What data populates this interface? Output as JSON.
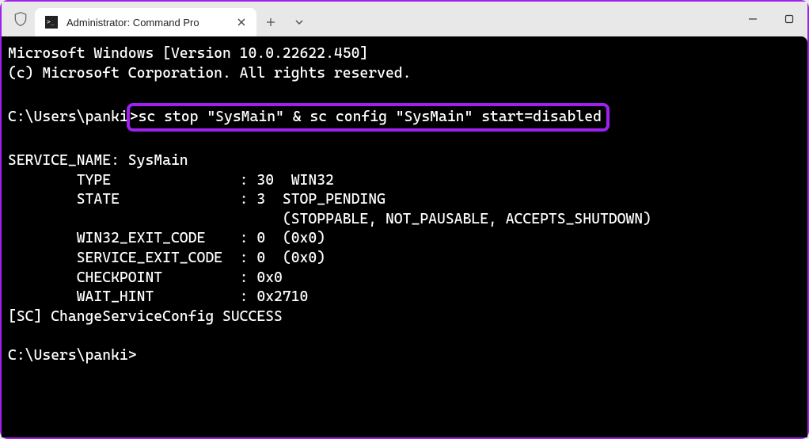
{
  "window": {
    "tab_title": "Administrator: Command Pro",
    "icons": {
      "shield": "shield-icon",
      "cmd": "cmd-icon",
      "close": "×",
      "plus": "+",
      "chevron": "⌄",
      "minimize": "—",
      "maximize": "▢"
    }
  },
  "terminal": {
    "header_line1": "Microsoft Windows [Version 10.0.22622.450]",
    "header_line2": "(c) Microsoft Corporation. All rights reserved.",
    "prompt1_prefix": "C:\\Users\\panki",
    "prompt1_command": ">sc stop \"SysMain\" & sc config \"SysMain\" start=disabled",
    "output": {
      "service_name": "SERVICE_NAME: SysMain",
      "type": "        TYPE               : 30  WIN32",
      "state": "        STATE              : 3  STOP_PENDING",
      "state_flags": "                                (STOPPABLE, NOT_PAUSABLE, ACCEPTS_SHUTDOWN)",
      "win32_exit": "        WIN32_EXIT_CODE    : 0  (0x0)",
      "service_exit": "        SERVICE_EXIT_CODE  : 0  (0x0)",
      "checkpoint": "        CHECKPOINT         : 0x0",
      "wait_hint": "        WAIT_HINT          : 0x2710",
      "sc_success": "[SC] ChangeServiceConfig SUCCESS"
    },
    "prompt2": "C:\\Users\\panki>"
  }
}
